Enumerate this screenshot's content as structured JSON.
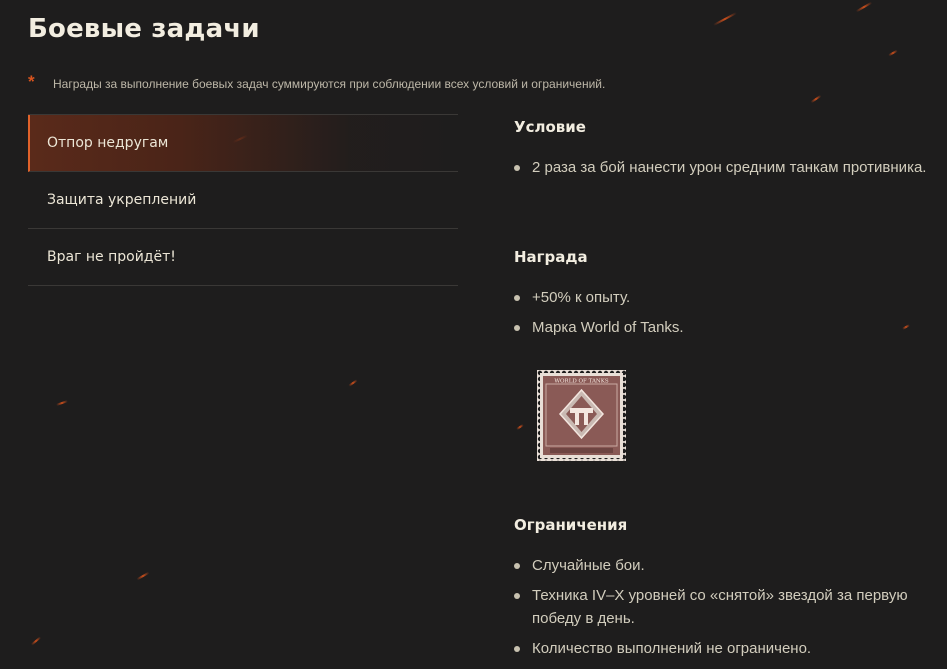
{
  "page": {
    "title": "Боевые задачи",
    "note_marker": "*",
    "note": "Награды за выполнение боевых задач суммируются при соблюдении всех условий и ограничений."
  },
  "tabs": [
    {
      "label": "Отпор недругам",
      "active": true
    },
    {
      "label": "Защита укреплений",
      "active": false
    },
    {
      "label": "Враг не пройдёт!",
      "active": false
    }
  ],
  "condition": {
    "title": "Условие",
    "items": [
      "2 раза за бой нанести урон средним танкам противника."
    ]
  },
  "reward": {
    "title": "Награда",
    "items": [
      "+50% к опыту.",
      "Марка World of Tanks."
    ],
    "stamp_text": "WORLD OF TANKS"
  },
  "restrictions": {
    "title": "Ограничения",
    "items": [
      "Случайные бои.",
      "Техника IV–X уровней со «снятой» звездой за первую победу в день.",
      "Количество выполнений не ограничено."
    ]
  },
  "colors": {
    "background": "#1e1d1d",
    "accent": "#e0622a",
    "stamp": "#8a5a56"
  }
}
